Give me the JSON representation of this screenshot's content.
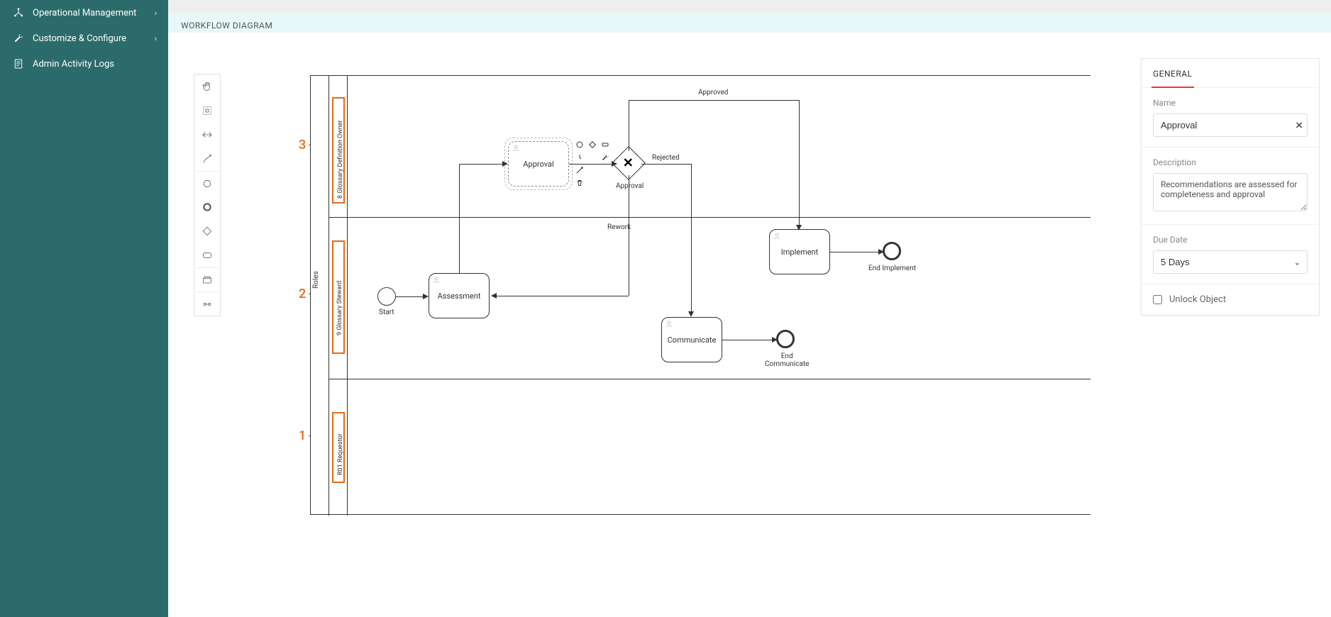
{
  "sidebar": {
    "items": [
      {
        "label": "Operational Management",
        "icon": "network-icon",
        "hasChildren": true
      },
      {
        "label": "Customize & Configure",
        "icon": "wrench-icon",
        "hasChildren": true
      },
      {
        "label": "Admin Activity Logs",
        "icon": "log-icon",
        "hasChildren": false
      }
    ]
  },
  "header": {
    "title": "WORKFLOW DIAGRAM"
  },
  "toolbox_items": [
    "hand",
    "lasso",
    "space",
    "connect",
    "event-start",
    "event-end",
    "gateway",
    "task",
    "subprocess",
    "participants",
    "data-object"
  ],
  "diagram": {
    "pool_label": "Roles",
    "lanes": [
      {
        "label": "8 Glossary Definition Owner",
        "anno_num": "3"
      },
      {
        "label": "9 Glossary Steward",
        "anno_num": "2"
      },
      {
        "label": "R01 Requestor",
        "anno_num": "1"
      }
    ],
    "start_label": "Start",
    "tasks": {
      "approval": "Approval",
      "assessment": "Assessment",
      "implement": "Implement",
      "communicate": "Communicate"
    },
    "gateway_label": "Approval",
    "edge_labels": {
      "approved": "Approved",
      "rejected": "Rejected",
      "rework": "Rework"
    },
    "end_labels": {
      "implement": "End Implement",
      "communicate": "End\nCommunicate"
    }
  },
  "properties": {
    "tab": "GENERAL",
    "name_label": "Name",
    "name_value": "Approval",
    "description_label": "Description",
    "description_value": "Recommendations are assessed for completeness and approval",
    "due_label": "Due Date",
    "due_value": "5 Days",
    "unlock_label": "Unlock Object"
  }
}
